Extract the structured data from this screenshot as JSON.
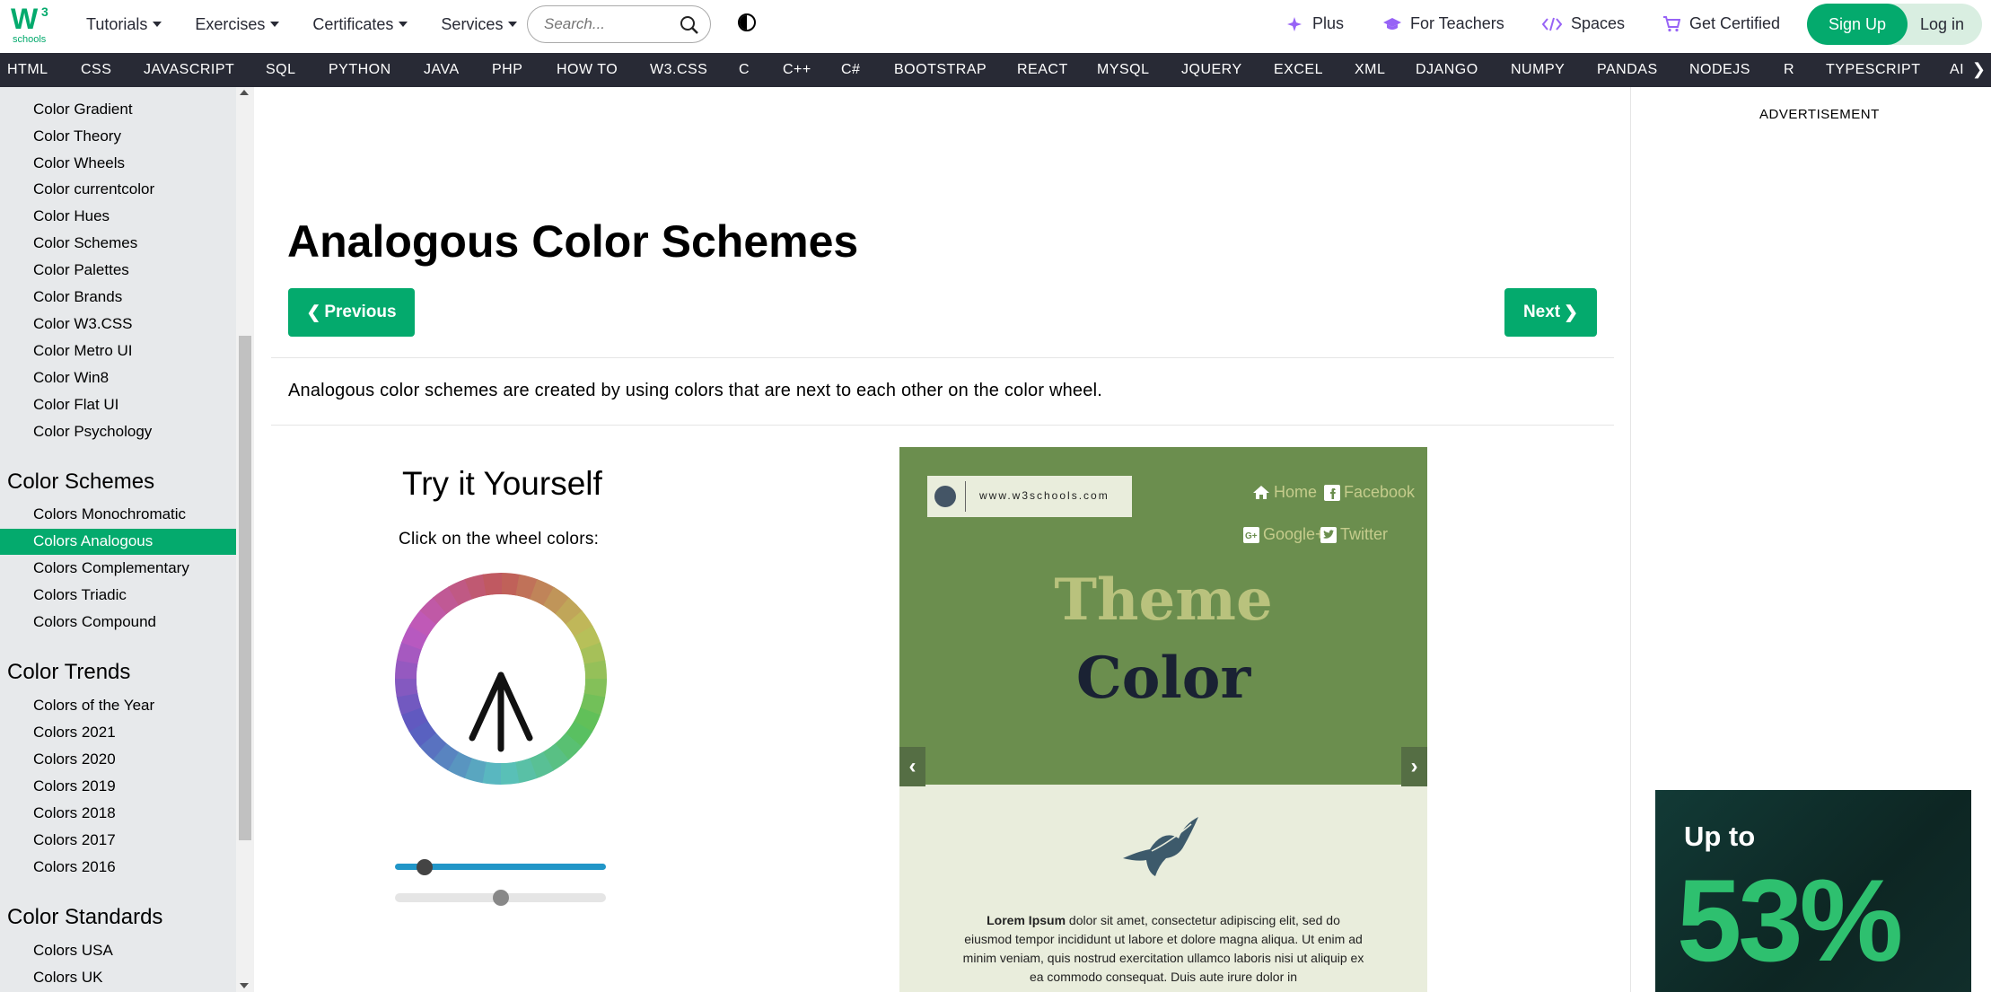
{
  "header": {
    "logo_text": "schools",
    "logo_sup": "3",
    "menu": [
      "Tutorials",
      "Exercises",
      "Certificates",
      "Services"
    ],
    "search_placeholder": "Search...",
    "right_links": [
      {
        "label": "Plus",
        "icon": "sparkle-icon"
      },
      {
        "label": "For Teachers",
        "icon": "graduation-cap-icon"
      },
      {
        "label": "Spaces",
        "icon": "code-icon"
      },
      {
        "label": "Get Certified",
        "icon": "cart-icon"
      }
    ],
    "signup_label": "Sign Up",
    "login_label": "Log in",
    "accent_color": "#04aa6d"
  },
  "subnav": [
    "HTML",
    "CSS",
    "JAVASCRIPT",
    "SQL",
    "PYTHON",
    "JAVA",
    "PHP",
    "HOW TO",
    "W3.CSS",
    "C",
    "C++",
    "C#",
    "BOOTSTRAP",
    "REACT",
    "MYSQL",
    "JQUERY",
    "EXCEL",
    "XML",
    "DJANGO",
    "NUMPY",
    "PANDAS",
    "NODEJS",
    "R",
    "TYPESCRIPT",
    "AI"
  ],
  "sidebar": {
    "group1": [
      "Color Gradient",
      "Color Theory",
      "Color Wheels",
      "Color currentcolor",
      "Color Hues",
      "Color Schemes",
      "Color Palettes",
      "Color Brands",
      "Color W3.CSS",
      "Color Metro UI",
      "Color Win8",
      "Color Flat UI",
      "Color Psychology"
    ],
    "schemes_heading": "Color Schemes",
    "schemes": [
      "Colors Monochromatic",
      "Colors Analogous",
      "Colors Complementary",
      "Colors Triadic",
      "Colors Compound"
    ],
    "active_item": "Colors Analogous",
    "trends_heading": "Color Trends",
    "trends": [
      "Colors of the Year",
      "Colors 2021",
      "Colors 2020",
      "Colors 2019",
      "Colors 2018",
      "Colors 2017",
      "Colors 2016"
    ],
    "standards_heading": "Color Standards",
    "standards": [
      "Colors USA",
      "Colors UK"
    ]
  },
  "main": {
    "title": "Analogous Color Schemes",
    "prev_label": "Previous",
    "next_label": "Next",
    "intro": "Analogous color schemes are created by using colors that are next to each other on the color wheel.",
    "try_title": "Try it Yourself",
    "try_sub": "Click on the wheel colors:",
    "slider1_value": 0.14,
    "slider2_value": 0.5
  },
  "theme_preview": {
    "url": "www.w3schools.com",
    "links": [
      "Home",
      "Facebook",
      "Google+",
      "Twitter"
    ],
    "heading1": "Theme",
    "heading2": "Color",
    "lorem_bold": "Lorem Ipsum",
    "lorem_rest": " dolor sit amet, consectetur adipiscing elit, sed do eiusmod tempor incididunt ut labore et dolore magna aliqua. Ut enim ad minim veniam, quis nostrud exercitation ullamco laboris nisi ut aliquip ex ea commodo consequat. Duis aute irure dolor in",
    "primary_color": "#6b8e4e",
    "light_color": "#e9eddc"
  },
  "ad": {
    "label": "ADVERTISEMENT",
    "line1": "Up to",
    "line2": "53%"
  }
}
